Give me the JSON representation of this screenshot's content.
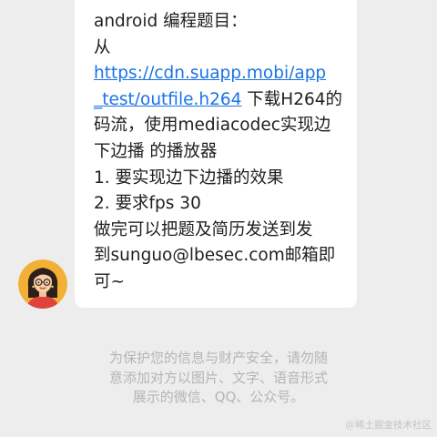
{
  "message": {
    "lines": [
      "android 编程题目：",
      "从",
      "https://cdn.suapp.mobi/app",
      "_test/outfile.h264",
      " 下载H264的",
      "码流，使用mediacodec实现边",
      "下边播 的播放器",
      "1. 要实现边下边播的效果",
      "2. 要求fps 30",
      "做完可以把题及简历发送到发",
      "到sunguo@lbesec.com邮箱即",
      "可~"
    ]
  },
  "avatar": {
    "label": "avatar"
  },
  "notice": {
    "lines": [
      "为保护您的信息与财产安全，请勿随",
      "意添加对方以图片、文字、语音形式",
      "展示的微信、QQ、公众号。"
    ]
  },
  "watermark": "@稀土掘金技术社区",
  "colors": {
    "background": "#ededed",
    "bubble": "#ffffff",
    "link": "#1a73e8",
    "notice_text": "#b5b5b5"
  }
}
